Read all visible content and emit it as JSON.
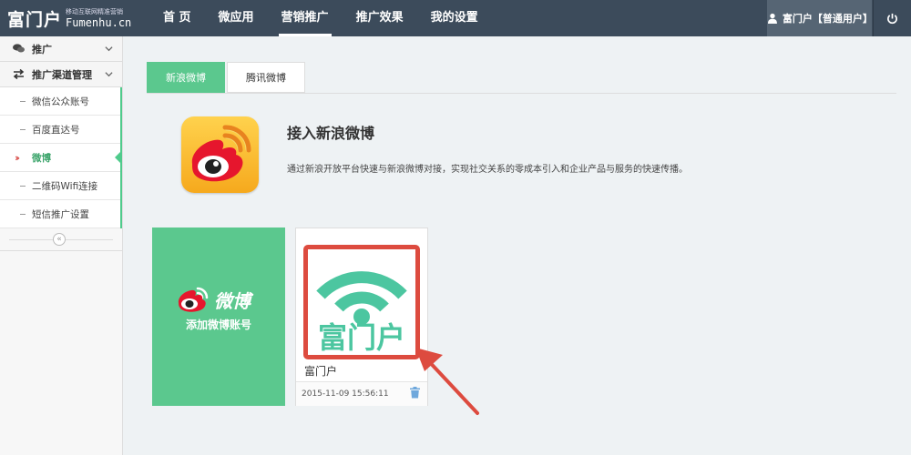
{
  "brand": {
    "logo_text": "富门户",
    "tagline": "移动互联网精准营销",
    "url": "Fumenhu.cn"
  },
  "nav": {
    "items": [
      {
        "label": "首 页"
      },
      {
        "label": "微应用"
      },
      {
        "label": "营销推广"
      },
      {
        "label": "推广效果"
      },
      {
        "label": "我的设置"
      }
    ],
    "active_index": 2
  },
  "user": {
    "label": "富门户【普通用户】"
  },
  "sidebar": {
    "promo_label": "推广",
    "channel_label": "推广渠道管理",
    "items": [
      {
        "label": "微信公众账号"
      },
      {
        "label": "百度直达号"
      },
      {
        "label": "微博"
      },
      {
        "label": "二维码Wifi连接"
      },
      {
        "label": "短信推广设置"
      }
    ],
    "active_index": 2,
    "collapse_symbol": "«"
  },
  "tabs": [
    {
      "label": "新浪微博"
    },
    {
      "label": "腾讯微博"
    }
  ],
  "intro": {
    "title": "接入新浪微博",
    "description": "通过新浪开放平台快速与新浪微博对接，实现社交关系的零成本引入和企业产品与服务的快速传播。"
  },
  "add_card": {
    "logo_text": "微博",
    "label": "添加微博账号"
  },
  "account": {
    "image_text": "富门户",
    "name": "富门户",
    "time": "2015-11-09 15:56:11"
  },
  "colors": {
    "topbar": "#3c4b5b",
    "accent_green": "#5bc88e",
    "highlight_red": "#dd4b3f",
    "weibo_red": "#e6162d",
    "logo_teal": "#4cc6a0"
  }
}
